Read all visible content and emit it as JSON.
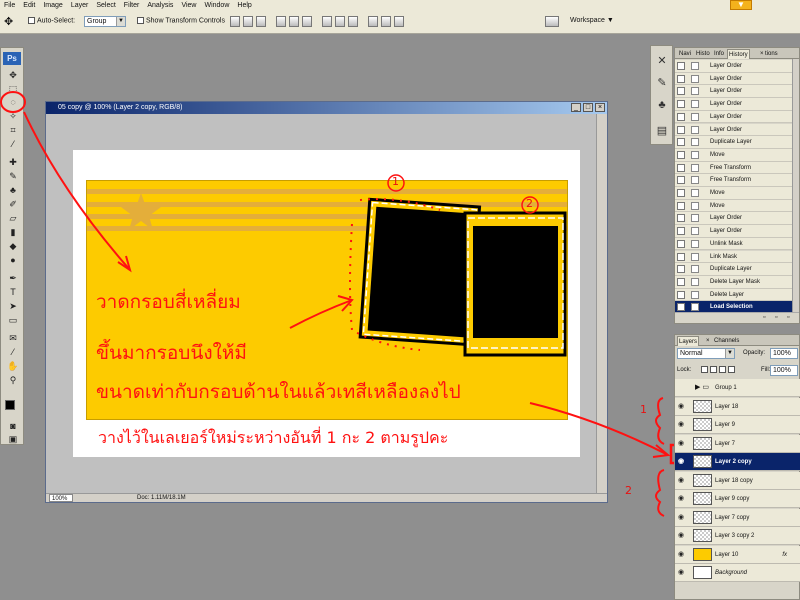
{
  "menubar": {
    "items": [
      "File",
      "Edit",
      "Image",
      "Layer",
      "Select",
      "Filter",
      "Analysis",
      "View",
      "Window",
      "Help"
    ]
  },
  "options": {
    "auto_select_label": "Auto-Select:",
    "auto_select_value": "Group",
    "transform_controls_label": "Show Transform Controls",
    "workspace_label": "Workspace"
  },
  "tools": {
    "logo": "Ps"
  },
  "document": {
    "title": "05 copy @ 100% (Layer 2 copy, RGB/8)",
    "zoom": "100%",
    "doc_info": "Doc: 1.11M/18.1M"
  },
  "history_panel": {
    "tabs": [
      "Navi",
      "Histo",
      "Info",
      "History",
      "tions"
    ],
    "active_tab": "History",
    "items": [
      "Layer Order",
      "Layer Order",
      "Layer Order",
      "Layer Order",
      "Layer Order",
      "Layer Order",
      "Duplicate Layer",
      "Move",
      "Free Transform",
      "Free Transform",
      "Move",
      "Move",
      "Layer Order",
      "Layer Order",
      "Unlink Mask",
      "Link Mask",
      "Duplicate Layer",
      "Delete Layer Mask",
      "Delete Layer",
      "Load Selection"
    ],
    "selected_index": 19
  },
  "layers_panel": {
    "tabs": [
      "Layers",
      "Channels"
    ],
    "blend_mode": "Normal",
    "opacity_label": "Opacity:",
    "opacity_value": "100%",
    "lock_label": "Lock:",
    "fill_label": "Fill:",
    "fill_value": "100%",
    "layers": [
      {
        "name": "Group 1",
        "kind": "group"
      },
      {
        "name": "Layer 18",
        "kind": "layer"
      },
      {
        "name": "Layer 9",
        "kind": "layer"
      },
      {
        "name": "Layer 7",
        "kind": "layer"
      },
      {
        "name": "Layer 2 copy",
        "kind": "layer",
        "selected": true
      },
      {
        "name": "Layer 18 copy",
        "kind": "layer"
      },
      {
        "name": "Layer 9 copy",
        "kind": "layer"
      },
      {
        "name": "Layer 7 copy",
        "kind": "layer"
      },
      {
        "name": "Layer 3 copy 2",
        "kind": "layer"
      },
      {
        "name": "Layer 10",
        "kind": "layer",
        "fx": "fx"
      },
      {
        "name": "Background",
        "kind": "layer",
        "italic": true
      }
    ]
  },
  "annotations": {
    "line1": "วาดกรอบสี่เหลี่ยม",
    "line2": "ขึ้นมากรอบนึงให้มี",
    "line3": "ขนาดเท่ากับกรอบด้านในแล้วเทสีเหลืองลงไป",
    "line4": "วางไว้ในเลเยอร์ใหม่ระหว่างอันที่ 1 กะ 2 ตามรูปคะ",
    "mark_1": "1",
    "mark_2": "2",
    "circle_1": "1",
    "circle_2": "2"
  },
  "colors": {
    "accent_red": "#ff1111",
    "artwork_yellow": "#fdcb00",
    "selection_blue": "#0a246a"
  }
}
